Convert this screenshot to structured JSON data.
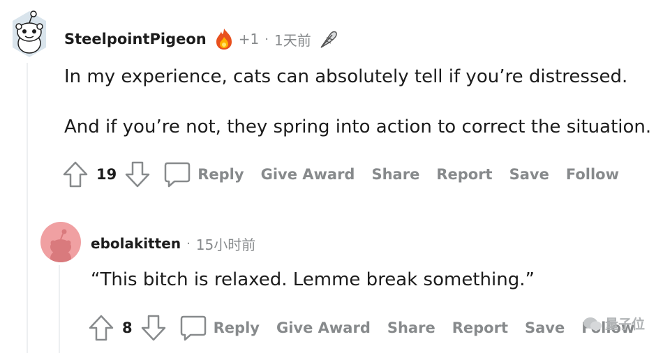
{
  "comment": {
    "username": "SteelpointPigeon",
    "award_count": "+1",
    "separator": "·",
    "time": "1天前",
    "paragraphs": [
      "In my experience, cats can absolutely tell if you’re distressed.",
      "And if you’re not, they spring into action to correct the situation."
    ],
    "score": "19",
    "actions": [
      "Reply",
      "Give Award",
      "Share",
      "Report",
      "Save",
      "Follow"
    ]
  },
  "reply": {
    "username": "ebolakitten",
    "separator": "·",
    "time": "15小时前",
    "text": "“This bitch is relaxed. Lemme break something.”",
    "score": "8",
    "actions": [
      "Reply",
      "Give Award",
      "Share",
      "Report",
      "Save",
      "Follow"
    ]
  },
  "watermark": {
    "text": "量子位"
  },
  "icons": {
    "avatar1": "snoo-avatar-icon",
    "flair": "fire-award-icon",
    "mod": "feather-icon",
    "upvote": "upvote-arrow-icon",
    "downvote": "downvote-arrow-icon",
    "comment": "comment-bubble-icon"
  },
  "colors": {
    "text": "#1c1c1c",
    "muted": "#878a8c",
    "avatar2_bg": "#f0a0a2"
  }
}
